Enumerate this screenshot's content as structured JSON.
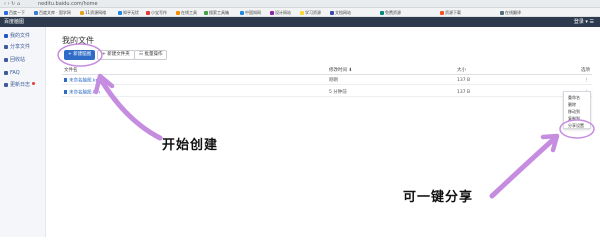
{
  "browser": {
    "url": "neditu.baidu.com/home",
    "nav_glyphs": "‹ › ↻ ⌂",
    "bookmarks": [
      {
        "label": "百度一下",
        "color": "#2d6be4"
      },
      {
        "label": "百度文库 · 国学网",
        "color": "#3a7bd5"
      },
      {
        "label": "11资源网络",
        "color": "#e0a41e"
      },
      {
        "label": "知乎无忧",
        "color": "#1e88e5"
      },
      {
        "label": "小宝写作",
        "color": "#e53935"
      },
      {
        "label": "在线工具",
        "color": "#fb8c00"
      },
      {
        "label": "搜索工具箱",
        "color": "#43a047"
      },
      {
        "label": "中国知网",
        "color": "#1e88e5"
      },
      {
        "label": "设计网站",
        "color": "#8e24aa"
      },
      {
        "label": "学习资源",
        "color": "#fdd835"
      },
      {
        "label": "文档网站",
        "color": "#3949ab"
      },
      {
        "label": "免费资源",
        "color": "#00897b"
      },
      {
        "label": "资源下载",
        "color": "#f4511e"
      },
      {
        "label": "在线翻译",
        "color": "#546e7a"
      }
    ]
  },
  "app": {
    "title": "百度脑图",
    "user_menu": "登录 ▾ ☰"
  },
  "sidebar": {
    "items": [
      {
        "label": "我的文件",
        "active": true,
        "dot": false
      },
      {
        "label": "分享文件",
        "active": false,
        "dot": false
      },
      {
        "label": "回收站",
        "active": false,
        "dot": false
      },
      {
        "label": "FAQ",
        "active": false,
        "dot": false
      },
      {
        "label": "更新日志",
        "active": false,
        "dot": true
      }
    ]
  },
  "main": {
    "title": "我的文件",
    "buttons": {
      "new_mindmap": "+ 新建脑图",
      "new_folder": "+ 新建文件夹",
      "batch": "☷ 批量操作"
    },
    "table": {
      "headers": {
        "name": "文件名",
        "modified": "修改时间 ⬇",
        "size": "大小",
        "actions": "选项"
      },
      "rows": [
        {
          "name": "未命名脑图.km",
          "modified": "刚刚",
          "size": "137 B",
          "menu": "⋮"
        },
        {
          "name": "未命名脑图.km",
          "modified": "5 分钟前",
          "size": "137 B",
          "menu": "⋮"
        }
      ]
    },
    "context_menu": {
      "items": [
        "重命名",
        "删除",
        "移动到",
        "复制到",
        "分享设置"
      ]
    }
  },
  "annotations": {
    "start_create": "开始创建",
    "one_click_share": "可一键分享",
    "color": "#c58ce0"
  }
}
